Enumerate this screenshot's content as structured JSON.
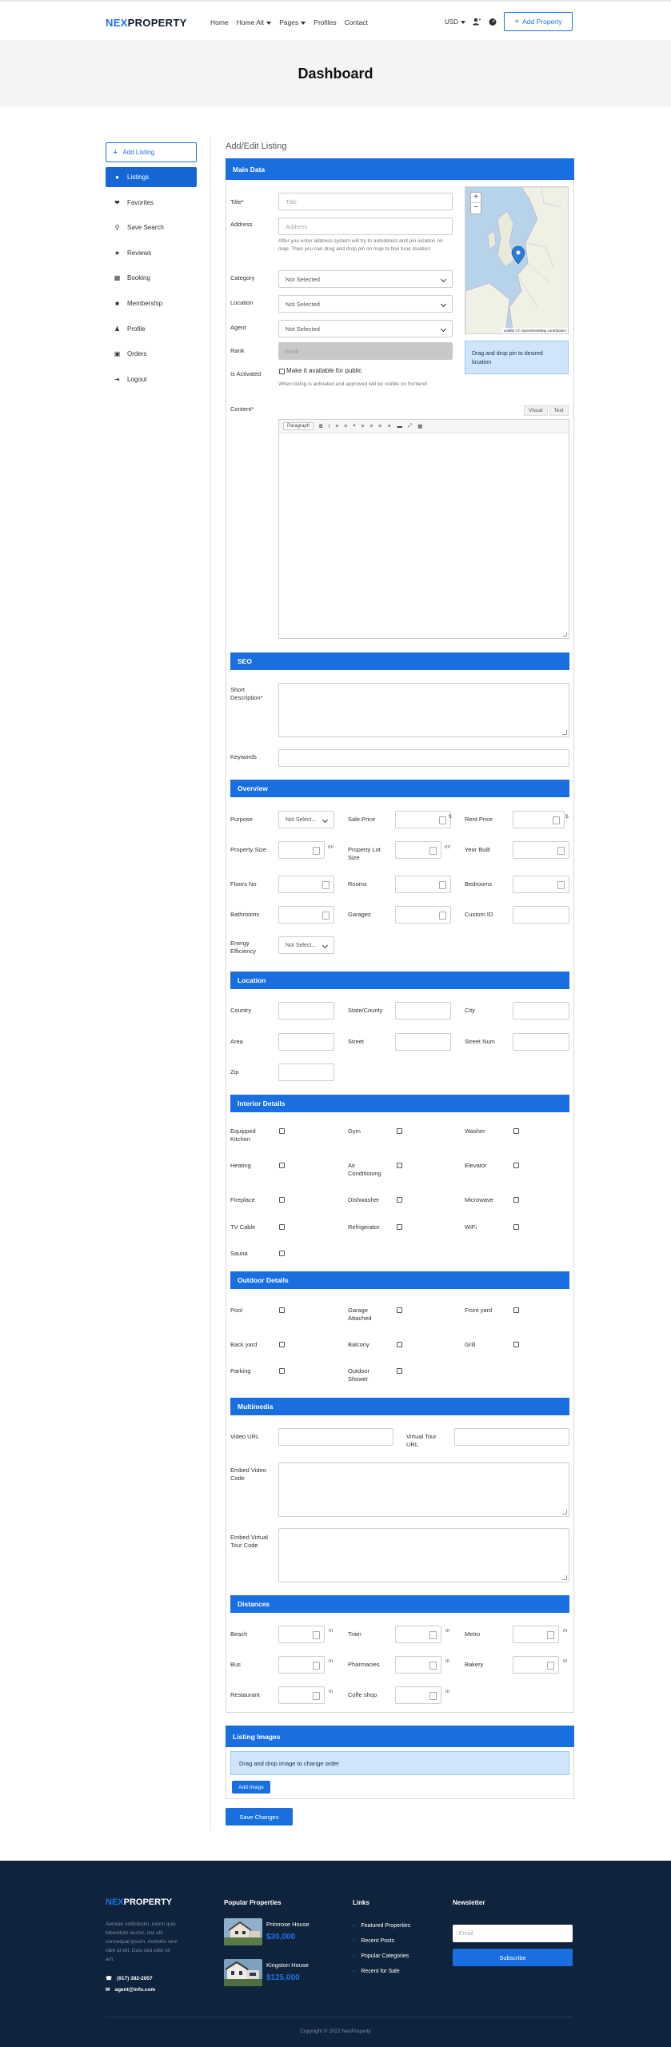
{
  "header": {
    "logo_a": "NEX",
    "logo_b": "PROPERTY",
    "nav": [
      "Home",
      "Home Alt",
      "Pages",
      "Profiles",
      "Contact"
    ],
    "currency": "USD",
    "add_property": "Add Property"
  },
  "banner": {
    "title": "Dashboard"
  },
  "sidebar": {
    "add_listing": "Add Listing",
    "items": [
      {
        "label": "Listings",
        "icon": "map-marker-icon"
      },
      {
        "label": "Favorites",
        "icon": "heart-icon"
      },
      {
        "label": "Save Search",
        "icon": "search-icon"
      },
      {
        "label": "Reviews",
        "icon": "star-icon"
      },
      {
        "label": "Booking",
        "icon": "calendar-icon"
      },
      {
        "label": "Membership",
        "icon": "package-icon"
      },
      {
        "label": "Profile",
        "icon": "user-icon"
      },
      {
        "label": "Orders",
        "icon": "cart-icon"
      },
      {
        "label": "Logout",
        "icon": "logout-icon"
      }
    ]
  },
  "main": {
    "title": "Add/Edit Listing",
    "main_data": {
      "heading": "Main Data",
      "title_label": "Title*",
      "title_placeholder": "Title",
      "address_label": "Address",
      "address_placeholder": "Address",
      "address_help": "After you enter address system will try to autodetect and pin location on map. Then you can drag and drop pin on map to fine tune location",
      "category_label": "Category",
      "location_label": "Location",
      "agent_label": "Agent",
      "not_selected": "Not Selected",
      "rank_label": "Rank",
      "rank_placeholder": "Rank",
      "activated_label": "Is Activated",
      "activated_check": "Make it available for public",
      "activated_help": "When listing is activated and approved will be visible on frontend",
      "map_attribution": "Leaflet | © OpenStreetMap contributors",
      "map_info": "Drag and drop pin to desired location",
      "content_label": "Content*",
      "editor_tabs": [
        "Visual",
        "Text"
      ],
      "paragraph": "Paragraph"
    },
    "seo": {
      "heading": "SEO",
      "short_desc_label": "Short Description*",
      "keywords_label": "Keywords"
    },
    "overview": {
      "heading": "Overview",
      "purpose": "Purpose",
      "sale_price": "Sale Price",
      "rent_price": "Rent Price",
      "property_size": "Property Size",
      "property_lot_size": "Property Lot Size",
      "year_built": "Year Built",
      "floors_no": "Floors No",
      "rooms": "Rooms",
      "bedrooms": "Bedrooms",
      "bathrooms": "Bathrooms",
      "garages": "Garages",
      "custom_id": "Custom ID",
      "energy_efficiency": "Energy Efficiency",
      "not_select": "Not Select...",
      "currency_sign": "$",
      "m2": "m²"
    },
    "location": {
      "heading": "Location",
      "country": "Country",
      "state": "State/County",
      "city": "City",
      "area": "Area",
      "street": "Street",
      "street_num": "Street Num",
      "zip": "Zip"
    },
    "interior": {
      "heading": "Interior Details",
      "items": [
        "Equipped Kitchen",
        "Gym",
        "Washer",
        "Heating",
        "Air Conditioning",
        "Elevator",
        "Fireplace",
        "Dishwasher",
        "Microwave",
        "TV Cable",
        "Refrigerator",
        "WiFi",
        "Sauna"
      ]
    },
    "outdoor": {
      "heading": "Outdoor Details",
      "items": [
        "Pool",
        "Garage Attached",
        "Front yard",
        "Back yard",
        "Balcony",
        "Grill",
        "Parking",
        "Outdoor Shower"
      ]
    },
    "multimedia": {
      "heading": "Multimedia",
      "video_url": "Video URL",
      "virtual_tour_url": "Virtual Tour URL",
      "embed_video": "Embed Video Code",
      "embed_tour": "Embed Virtual Tour Code"
    },
    "distances": {
      "heading": "Distances",
      "items": [
        "Beach",
        "Train",
        "Metro",
        "Bus",
        "Pharmacies",
        "Bakery",
        "Restaurant",
        "Coffe shop"
      ],
      "unit": "m"
    },
    "images": {
      "heading": "Listing Images",
      "info": "Drag and drop image to change order",
      "add_image": "Add Image"
    },
    "save_button": "Save Changes"
  },
  "footer": {
    "logo_a": "NEX",
    "logo_b": "PROPERTY",
    "desc": "Aenean sollicitudin, lorem quis bibendum auctor, nisi elit consequat ipsum, morbhis sem nibh id elit. Duis sed odio sit am.",
    "phone": "(917) 382-2057",
    "email": "agent@info.com",
    "popular_heading": "Popular Properties",
    "properties": [
      {
        "name": "Primrose House",
        "price": "$30,000"
      },
      {
        "name": "Kingston House",
        "price": "$125,000"
      }
    ],
    "links_heading": "Links",
    "links": [
      "Featured Properties",
      "Recent Posts",
      "Popular Categories",
      "Recent for Sale"
    ],
    "newsletter_heading": "Newsletter",
    "email_placeholder": "Email",
    "subscribe": "Subscribe",
    "copyright": "Copyright © 2022 NexProperty"
  },
  "colors": {
    "accent": "#1a6fe0",
    "footer_bg": "#10233d"
  }
}
